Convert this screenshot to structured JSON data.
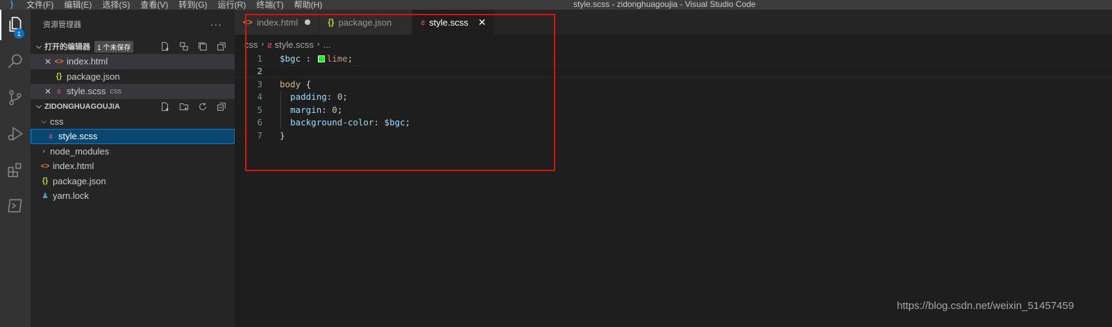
{
  "window": {
    "title": "style.scss - zidonghuagoujia - Visual Studio Code",
    "menu": [
      "文件(F)",
      "编辑(E)",
      "选择(S)",
      "查看(V)",
      "转到(G)",
      "运行(R)",
      "终端(T)",
      "帮助(H)"
    ]
  },
  "activity_bar": {
    "explorer_badge": "1"
  },
  "sidebar": {
    "title": "资源管理器",
    "more": "···",
    "open_editors": {
      "title": "打开的编辑器",
      "unsaved_badge": "1 个未保存",
      "items": [
        {
          "label": "index.html",
          "icon": "html-file-icon",
          "desc": ""
        },
        {
          "label": "package.json",
          "icon": "json-file-icon",
          "desc": ""
        },
        {
          "label": "style.scss",
          "icon": "scss-file-icon",
          "desc": "css"
        }
      ]
    },
    "folder": {
      "title": "ZIDONGHUAGOUJIA",
      "tree": [
        {
          "label": "css"
        },
        {
          "label": "style.scss"
        },
        {
          "label": "node_modules"
        },
        {
          "label": "index.html"
        },
        {
          "label": "package.json"
        },
        {
          "label": "yarn.lock"
        }
      ]
    }
  },
  "tabs": [
    {
      "label": "index.html",
      "dirty": true
    },
    {
      "label": "package.json",
      "dirty": false
    },
    {
      "label": "style.scss",
      "active": true
    }
  ],
  "breadcrumb": [
    "css",
    "style.scss",
    "..."
  ],
  "editor": {
    "lines": [
      {
        "num": "1",
        "tokens": [
          [
            "var",
            "$bgc"
          ],
          [
            "punc",
            " : "
          ],
          [
            "swatch",
            ""
          ],
          [
            "val",
            "lime"
          ],
          [
            "punc",
            ";"
          ]
        ]
      },
      {
        "num": "2",
        "tokens": []
      },
      {
        "num": "3",
        "tokens": [
          [
            "sel",
            "body"
          ],
          [
            "punc",
            " {"
          ]
        ]
      },
      {
        "num": "4",
        "tokens": [
          [
            "punc",
            "  "
          ],
          [
            "prop",
            "padding"
          ],
          [
            "punc",
            ": "
          ],
          [
            "num",
            "0"
          ],
          [
            "punc",
            ";"
          ]
        ]
      },
      {
        "num": "5",
        "tokens": [
          [
            "punc",
            "  "
          ],
          [
            "prop",
            "margin"
          ],
          [
            "punc",
            ": "
          ],
          [
            "num",
            "0"
          ],
          [
            "punc",
            ";"
          ]
        ]
      },
      {
        "num": "6",
        "tokens": [
          [
            "punc",
            "  "
          ],
          [
            "prop",
            "background-color"
          ],
          [
            "punc",
            ": "
          ],
          [
            "var",
            "$bgc"
          ],
          [
            "punc",
            ";"
          ]
        ]
      },
      {
        "num": "7",
        "tokens": [
          [
            "punc",
            "}"
          ]
        ]
      }
    ],
    "current_line": 2
  },
  "watermark": "https://blog.csdn.net/weixin_51457459",
  "colors": {
    "accent": "#0e70c0",
    "annotation_box": "#e01010",
    "lime_swatch": "#00ff00"
  }
}
